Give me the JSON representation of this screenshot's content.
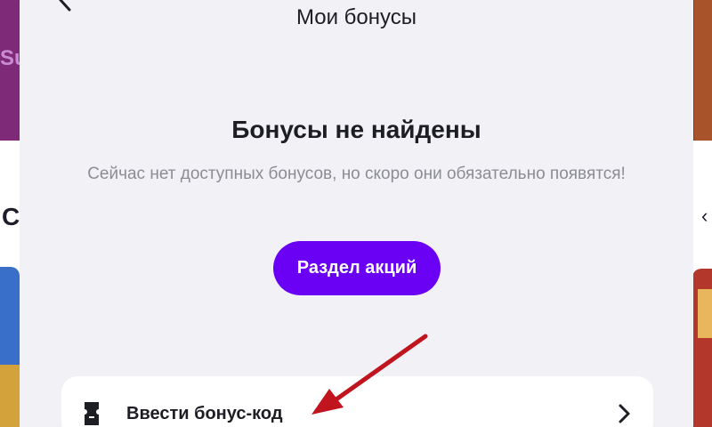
{
  "background": {
    "banner_text": "Su",
    "section_letter": "C",
    "section_chevron": "‹"
  },
  "modal": {
    "title": "Мои бонусы",
    "empty_title": "Бонусы не найдены",
    "empty_description": "Сейчас нет доступных бонусов, но скоро они обязательно появятся!",
    "promo_button_label": "Раздел акций",
    "bonus_code_label": "Ввести бонус-код"
  },
  "icons": {
    "back": "chevron-left-icon",
    "bonus_code": "ticket-icon",
    "row_chevron": "chevron-right-icon"
  },
  "colors": {
    "accent": "#6a00f4",
    "modal_bg": "#f1f1f6",
    "annotation": "#c0141e"
  }
}
